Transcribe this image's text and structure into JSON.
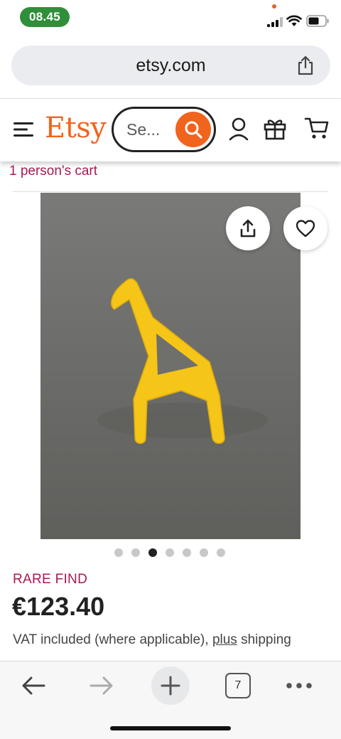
{
  "status_bar": {
    "time": "08.45",
    "icons": [
      "signal-icon",
      "wifi-icon",
      "battery-icon"
    ]
  },
  "browser": {
    "url": "etsy.com",
    "open_tab_count": "7",
    "toolbar_icons": [
      "back-arrow-icon",
      "forward-arrow-icon",
      "plus-icon",
      "tabs-icon",
      "more-icon"
    ]
  },
  "site_header": {
    "logo": "Etsy",
    "search_placeholder": "Se...",
    "icons": [
      "menu-icon",
      "search-icon",
      "account-icon",
      "gift-icon",
      "cart-icon"
    ]
  },
  "product": {
    "cart_note": "1 person's cart",
    "image_count": 7,
    "active_image_index": 2,
    "badge": "RARE FIND",
    "price": "€123.40",
    "vat_text": "VAT included (where applicable),",
    "vat_link": "plus",
    "vat_text_after": "shipping"
  },
  "colors": {
    "brand_orange": "#f1641e",
    "badge_magenta": "#a61a54",
    "time_pill_green": "#2f8f3a",
    "giraffe_yellow": "#f5c518"
  }
}
